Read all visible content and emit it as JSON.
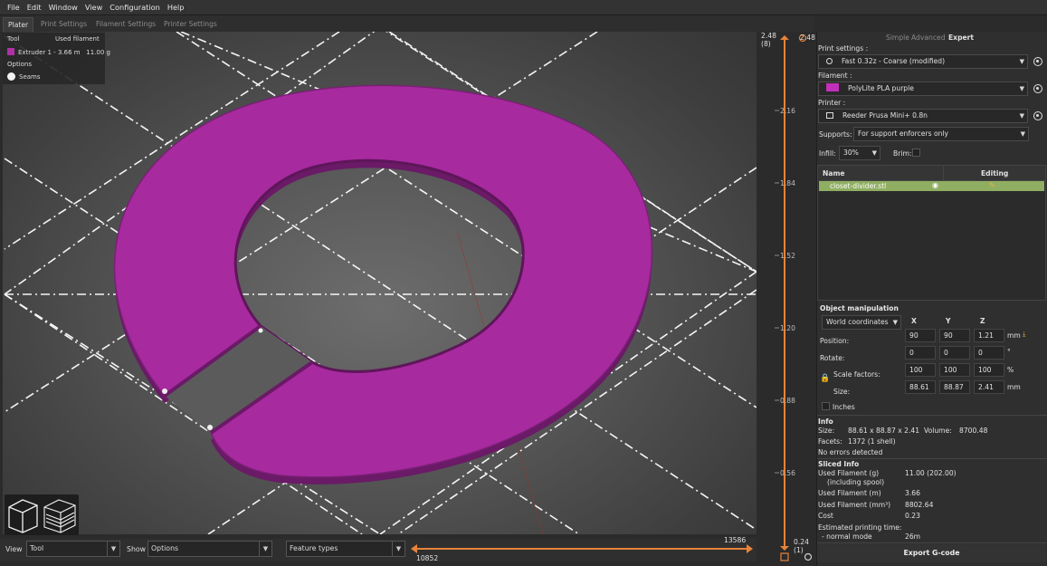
{
  "menu": [
    "File",
    "Edit",
    "Window",
    "View",
    "Configuration",
    "Help"
  ],
  "tabs": [
    "Plater",
    "Print Settings",
    "Filament Settings",
    "Printer Settings"
  ],
  "legend": {
    "col_tool": "Tool",
    "col_used": "Used filament",
    "extruder_label": "Extruder 1",
    "extruder_dash": "-",
    "extruder_length": "3.66 m",
    "extruder_weight": "11.00 g",
    "options_header": "Options",
    "seams_label": "Seams"
  },
  "bottom": {
    "view_label": "View",
    "view_value": "Tool",
    "show_label": "Show",
    "show_value": "Options",
    "feature_value": "Feature types"
  },
  "hslider": {
    "start": "10852",
    "end": "13586"
  },
  "vslider": {
    "top_value": "2.48",
    "top_layer": "(8)",
    "ticks": [
      "2.16",
      "1.84",
      "1.52",
      "1.20",
      "0.88",
      "0.56"
    ],
    "bottom_value": "0.24",
    "bottom_layer": "(1)"
  },
  "sidebar": {
    "modes": [
      "Simple",
      "Advanced",
      "Expert"
    ],
    "print_settings_label": "Print settings :",
    "print_settings_value": "Fast 0.32z - Coarse (modified)",
    "filament_label": "Filament :",
    "filament_value": "PolyLite PLA purple",
    "filament_color": "#c030b8",
    "printer_label": "Printer :",
    "printer_value": "Reeder Prusa Mini+ 0.8n",
    "supports_label": "Supports:",
    "supports_value": "For support enforcers only",
    "infill_label": "Infill:",
    "infill_value": "30%",
    "brim_label": "Brim:",
    "objects": {
      "col_name": "Name",
      "col_editing": "Editing",
      "rows": [
        {
          "name": "closet-divider.stl"
        }
      ]
    },
    "manip": {
      "header": "Object manipulation",
      "coord_value": "World coordinates",
      "axes": [
        "X",
        "Y",
        "Z"
      ],
      "position_label": "Position:",
      "position": [
        "90",
        "90",
        "1.21"
      ],
      "position_unit": "mm",
      "rotate_label": "Rotate:",
      "rotate": [
        "0",
        "0",
        "0"
      ],
      "rotate_unit": "°",
      "scale_label": "Scale factors:",
      "scale": [
        "100",
        "100",
        "100"
      ],
      "scale_unit": "%",
      "size_label": "Size:",
      "size": [
        "88.61",
        "88.87",
        "2.41"
      ],
      "size_unit": "mm",
      "inches_label": "Inches"
    },
    "info": {
      "header": "Info",
      "size_label": "Size:",
      "size_value": "88.61 x 88.87 x 2.41",
      "volume_label": "Volume:",
      "volume_value": "8700.48",
      "facets_label": "Facets:",
      "facets_value": "1372 (1 shell)",
      "errors": "No errors detected"
    },
    "sliced": {
      "header": "Sliced Info",
      "rows": [
        {
          "label": "Used Filament (g)",
          "sub": "(including spool)",
          "value": "11.00 (202.00)"
        },
        {
          "label": "Used Filament (m)",
          "value": "3.66"
        },
        {
          "label": "Used Filament (mm³)",
          "value": "8802.64"
        },
        {
          "label": "Cost",
          "value": "0.23"
        },
        {
          "label": "Estimated printing time:",
          "sub": "- normal mode",
          "value": "26m"
        }
      ]
    },
    "export_label": "Export G-code"
  }
}
